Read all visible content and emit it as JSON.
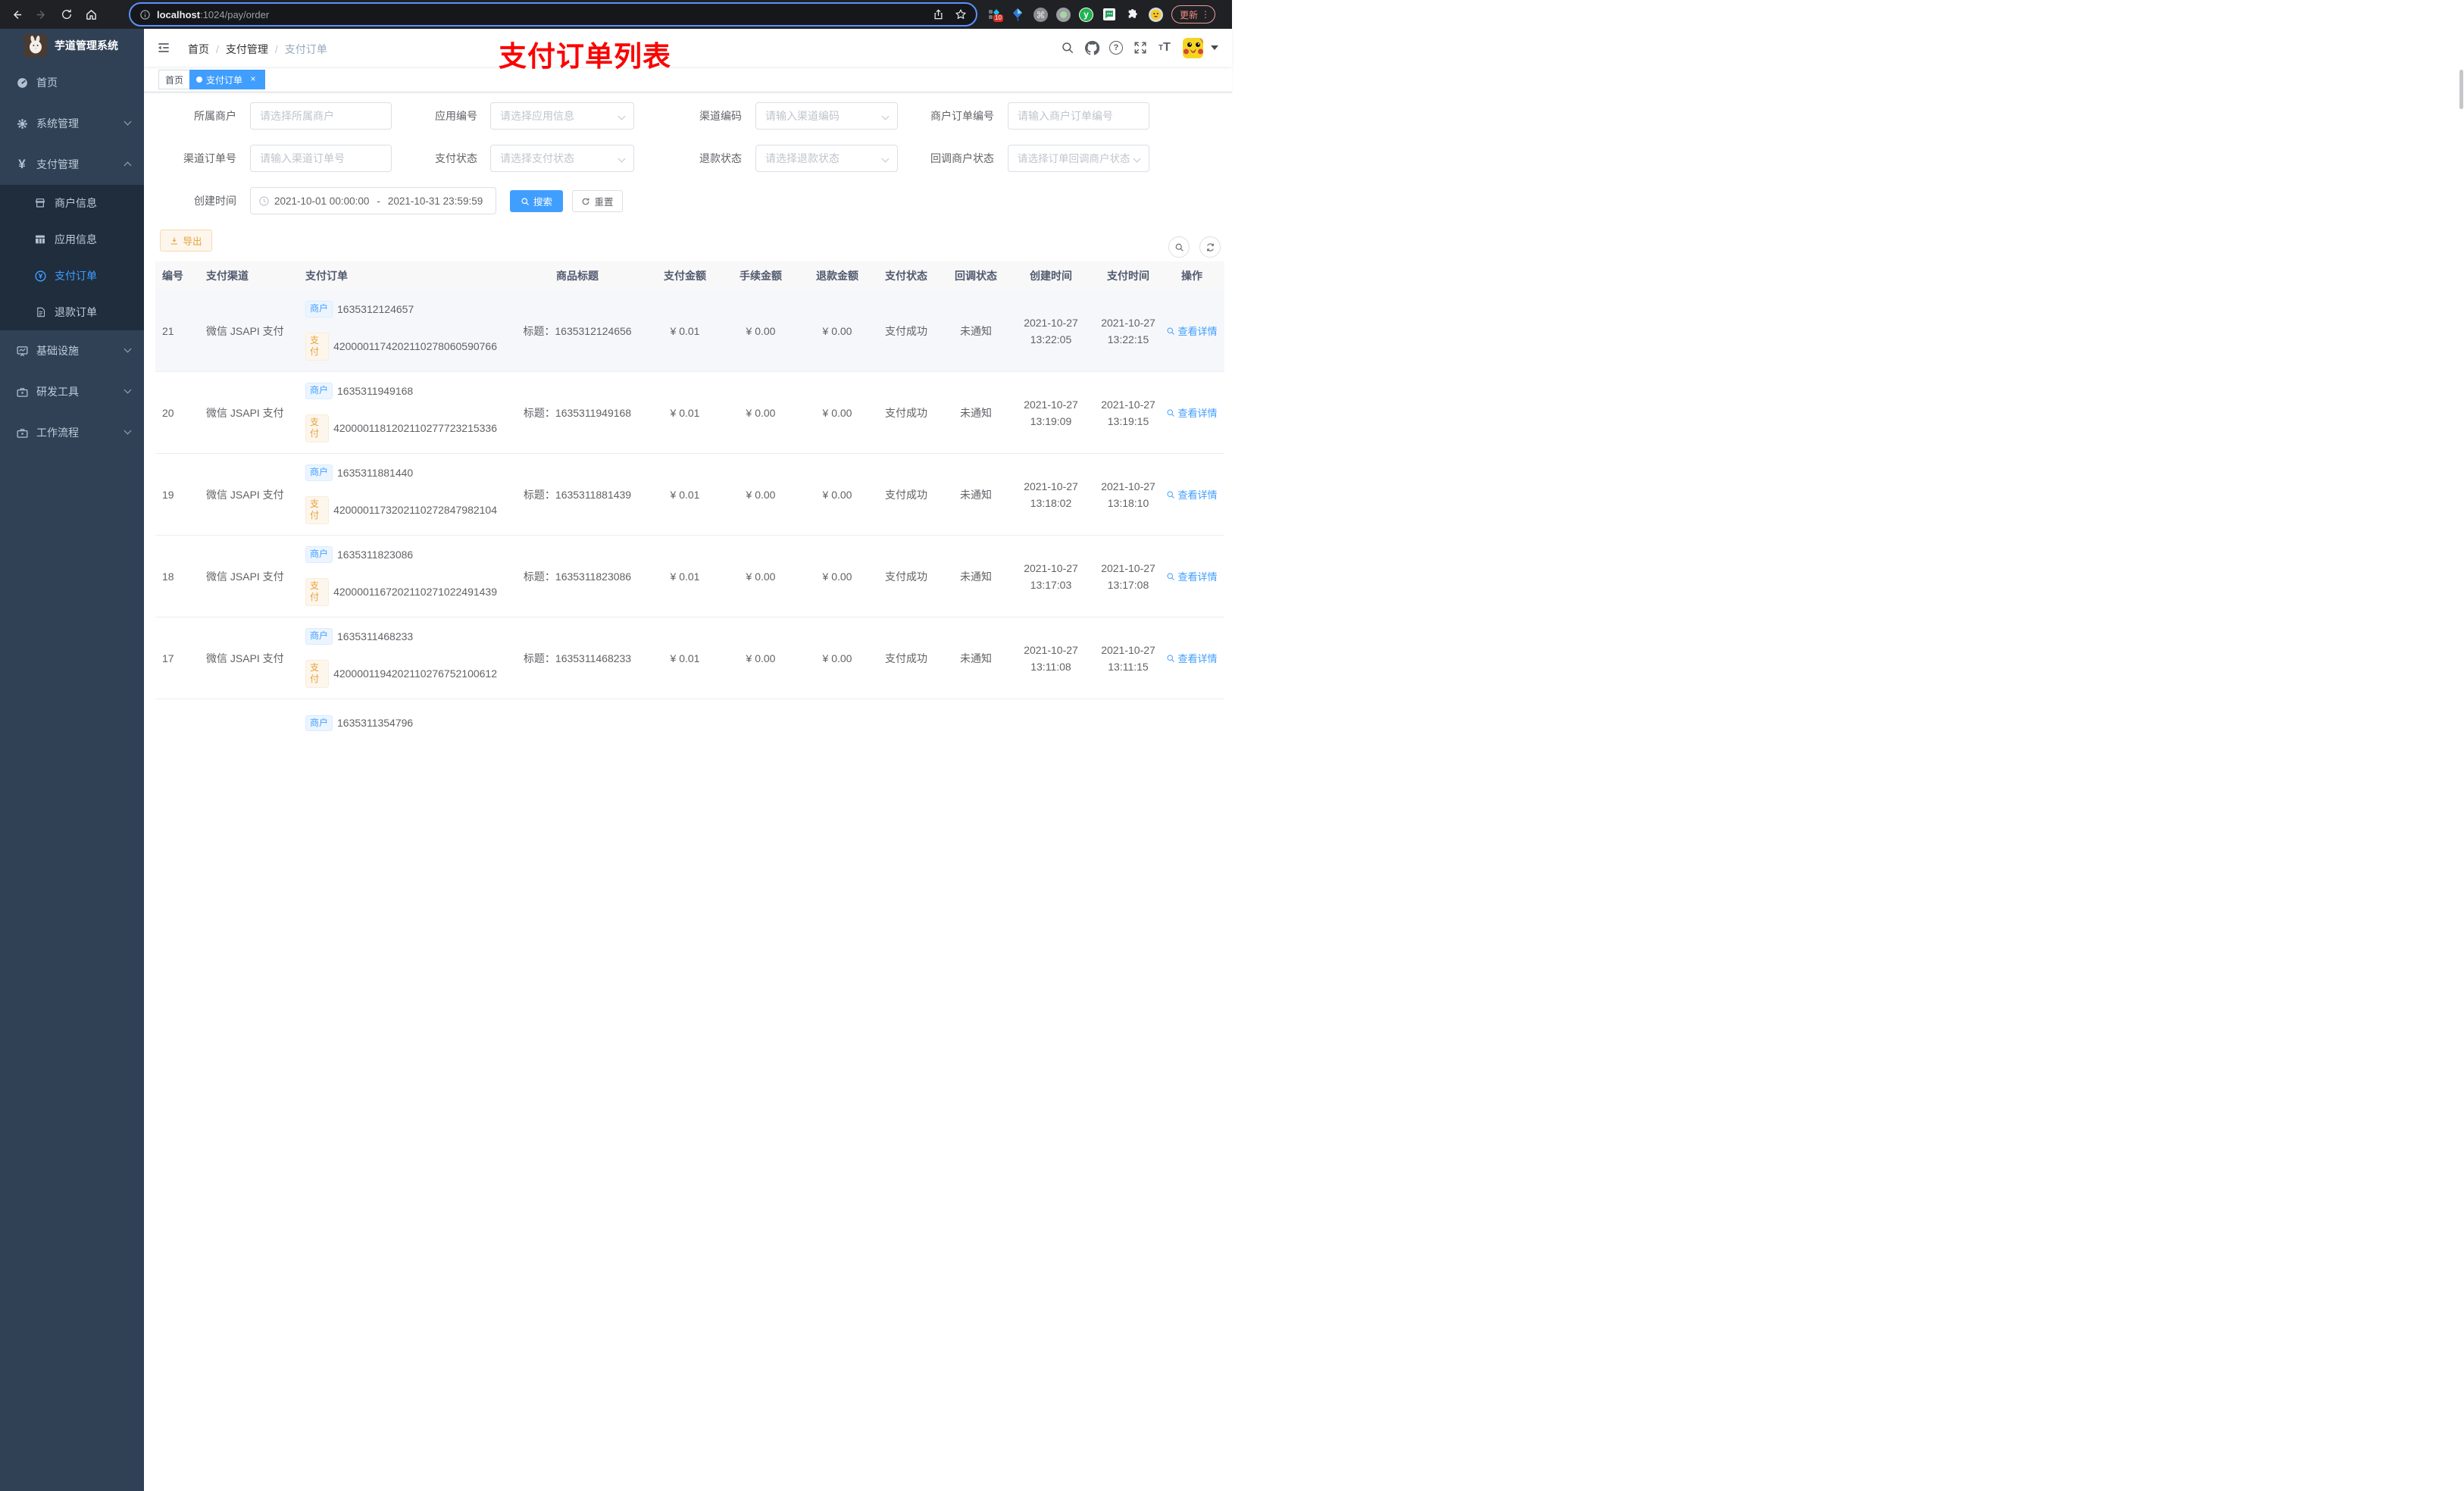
{
  "browser": {
    "url_host": "localhost",
    "url_rest": ":1024/pay/order",
    "ext_badge": "10",
    "update_label": "更新"
  },
  "sidebar": {
    "title": "芋道管理系统",
    "items": [
      {
        "label": "首页"
      },
      {
        "label": "系统管理"
      },
      {
        "label": "支付管理",
        "children": [
          {
            "label": "商户信息"
          },
          {
            "label": "应用信息"
          },
          {
            "label": "支付订单"
          },
          {
            "label": "退款订单"
          }
        ]
      },
      {
        "label": "基础设施"
      },
      {
        "label": "研发工具"
      },
      {
        "label": "工作流程"
      }
    ]
  },
  "navbar": {
    "breadcrumb": [
      "首页",
      "支付管理",
      "支付订单"
    ],
    "annotation": "支付订单列表"
  },
  "tags": {
    "home": "首页",
    "active": "支付订单"
  },
  "filters": {
    "fields": [
      {
        "label": "所属商户",
        "placeholder": "请选择所属商户"
      },
      {
        "label": "应用编号",
        "placeholder": "请选择应用信息"
      },
      {
        "label": "渠道编码",
        "placeholder": "请输入渠道编码"
      },
      {
        "label": "商户订单编号",
        "placeholder": "请输入商户订单编号"
      },
      {
        "label": "渠道订单号",
        "placeholder": "请输入渠道订单号"
      },
      {
        "label": "支付状态",
        "placeholder": "请选择支付状态"
      },
      {
        "label": "退款状态",
        "placeholder": "请选择退款状态"
      },
      {
        "label": "回调商户状态",
        "placeholder": "请选择订单回调商户状态"
      }
    ],
    "date": {
      "label": "创建时间",
      "start": "2021-10-01 00:00:00",
      "separator": "-",
      "end": "2021-10-31 23:59:59"
    },
    "search_label": "搜索",
    "reset_label": "重置"
  },
  "toolbar": {
    "export_label": "导出"
  },
  "table": {
    "headers": [
      "编号",
      "支付渠道",
      "支付订单",
      "商品标题",
      "支付金额",
      "手续金额",
      "退款金额",
      "支付状态",
      "回调状态",
      "创建时间",
      "支付时间",
      "操作"
    ],
    "merchant_tag": "商户",
    "pay_tag": "支付",
    "action_label": "查看详情",
    "rows": [
      {
        "id": "21",
        "channel": "微信 JSAPI 支付",
        "merchant_no": "1635312124657",
        "channel_no": "4200001174202110278060590766",
        "title": "标题：1635312124656",
        "pay_amount": "¥ 0.01",
        "fee_amount": "¥ 0.00",
        "refund_amount": "¥ 0.00",
        "pay_status": "支付成功",
        "notify_status": "未通知",
        "create_time": "2021-10-27\n13:22:05",
        "pay_time": "2021-10-27\n13:22:15"
      },
      {
        "id": "20",
        "channel": "微信 JSAPI 支付",
        "merchant_no": "1635311949168",
        "channel_no": "4200001181202110277723215336",
        "title": "标题：1635311949168",
        "pay_amount": "¥ 0.01",
        "fee_amount": "¥ 0.00",
        "refund_amount": "¥ 0.00",
        "pay_status": "支付成功",
        "notify_status": "未通知",
        "create_time": "2021-10-27\n13:19:09",
        "pay_time": "2021-10-27\n13:19:15"
      },
      {
        "id": "19",
        "channel": "微信 JSAPI 支付",
        "merchant_no": "1635311881440",
        "channel_no": "4200001173202110272847982104",
        "title": "标题：1635311881439",
        "pay_amount": "¥ 0.01",
        "fee_amount": "¥ 0.00",
        "refund_amount": "¥ 0.00",
        "pay_status": "支付成功",
        "notify_status": "未通知",
        "create_time": "2021-10-27\n13:18:02",
        "pay_time": "2021-10-27\n13:18:10"
      },
      {
        "id": "18",
        "channel": "微信 JSAPI 支付",
        "merchant_no": "1635311823086",
        "channel_no": "4200001167202110271022491439",
        "title": "标题：1635311823086",
        "pay_amount": "¥ 0.01",
        "fee_amount": "¥ 0.00",
        "refund_amount": "¥ 0.00",
        "pay_status": "支付成功",
        "notify_status": "未通知",
        "create_time": "2021-10-27\n13:17:03",
        "pay_time": "2021-10-27\n13:17:08"
      },
      {
        "id": "17",
        "channel": "微信 JSAPI 支付",
        "merchant_no": "1635311468233",
        "channel_no": "4200001194202110276752100612",
        "title": "标题：1635311468233",
        "pay_amount": "¥ 0.01",
        "fee_amount": "¥ 0.00",
        "refund_amount": "¥ 0.00",
        "pay_status": "支付成功",
        "notify_status": "未通知",
        "create_time": "2021-10-27\n13:11:08",
        "pay_time": "2021-10-27\n13:11:15"
      }
    ],
    "partial_row": {
      "merchant_no": "1635311354796"
    }
  }
}
